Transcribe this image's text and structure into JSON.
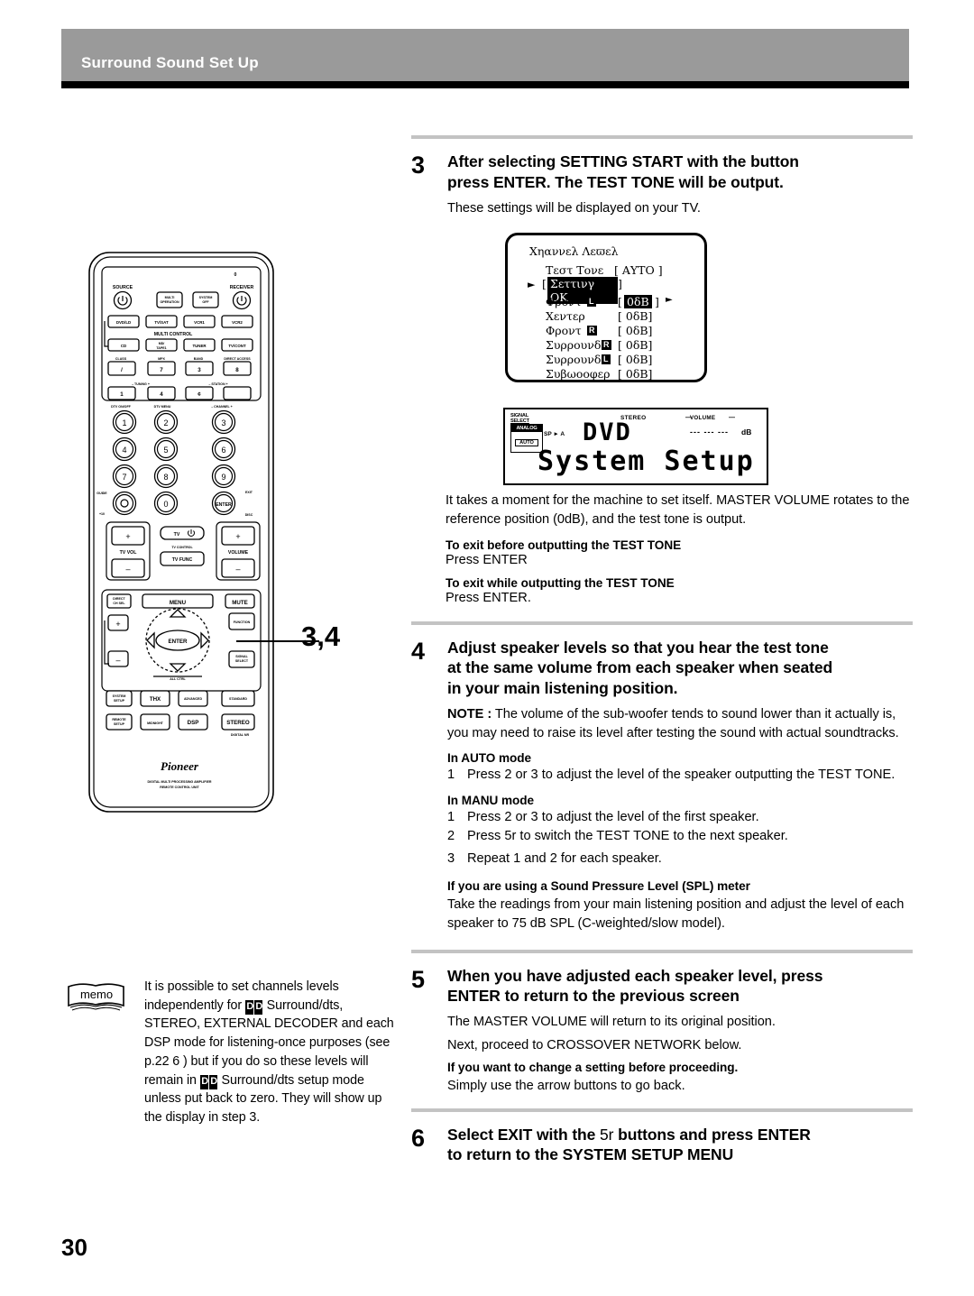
{
  "header": {
    "title": "Surround Sound Set Up"
  },
  "page": {
    "number": "30"
  },
  "callout": {
    "label": "3,4"
  },
  "steps": [
    {
      "num": "3",
      "title_line1": "After selecting SETTING START with the    button",
      "title_line2": "press ENTER. The TEST TONE will be output.",
      "intro": "These settings will be displayed on your  TV.",
      "body_para": "It takes a moment for the machine to set itself. MASTER VOLUME rotates to the reference position (0dB), and the test tone is output.",
      "exit_before_heading": "To exit before outputting the TEST TONE",
      "exit_before_text": "Press ENTER",
      "exit_while_heading": "To exit while outputting the TEST TONE",
      "exit_while_text": "Press ENTER."
    },
    {
      "num": "4",
      "title_line1": "Adjust speaker levels so that you hear the test tone",
      "title_line2": "at the same volume from each speaker when seated",
      "title_line3": "in your main listening position.",
      "note_label": "NOTE :",
      "note_text": " The volume of the sub-woofer tends to sound lower than it actually is, you may need to raise its level after testing the sound with actual soundtracks.",
      "auto_heading": "In AUTO mode",
      "auto_items": [
        {
          "n": "1",
          "t": "Press 2  or 3  to adjust the level of the speaker outputting the TEST TONE."
        }
      ],
      "manu_heading": "In MANU mode",
      "manu_items": [
        {
          "n": "1",
          "t": "Press 2  or 3  to adjust the level of the first speaker."
        },
        {
          "n": "2",
          "t": "Press  5r    to  switch the TEST TONE to the next speaker."
        },
        {
          "n": "3",
          "t": "Repeat 1  and 2  for each speaker."
        }
      ],
      "spl_heading": "If you are using a Sound Pressure Level (SPL) meter",
      "spl_text": "Take the readings from your main listening position and adjust the level of each speaker to 75 dB SPL (C-weighted/slow model)."
    },
    {
      "num": "5",
      "title_line1": "When you have adjusted each speaker level, press",
      "title_line2": "ENTER to return to the previous screen",
      "line1": "The MASTER VOLUME will return to its original position.",
      "line2": "Next, proceed to CROSSOVER NETWORK below.",
      "change_heading": "If you want to change a setting before proceeding.",
      "change_text": "Simply use the arrow buttons to go back."
    },
    {
      "num": "6",
      "title_line1_a": "Select EXIT with the ",
      "title_line1_b": "5r",
      "title_line1_c": "    buttons and press ENTER",
      "title_line2": "to return to the SYSTEM  SETUP MENU"
    }
  ],
  "osd": {
    "title": "Χηαννελ Λεϖελ",
    "test_tone_label": "Τεστ Τονε",
    "test_tone_value": "[ ΑΥΤΟ ]",
    "setting_ok": "Σεττινγ ΟΚ",
    "setting_ok_bracket_open": "[",
    "setting_ok_bracket_close": "]",
    "cursor": "►",
    "rows": [
      {
        "label": "Φροντ",
        "chip": "L",
        "value": "0δB",
        "bracket_open": "[",
        "bracket_close": "]",
        "selected": true,
        "left_arrow": "◄",
        "right_arrow": "►"
      },
      {
        "label": "Χεντερ",
        "chip": "",
        "value": "0δB",
        "bracket_open": "[",
        "bracket_close": "]",
        "selected": false
      },
      {
        "label": "Φροντ",
        "chip": "R",
        "value": "0δB",
        "bracket_open": "[",
        "bracket_close": "]",
        "selected": false
      },
      {
        "label": "Συρρουνδ",
        "chip": "R",
        "value": "0δB",
        "bracket_open": "[",
        "bracket_close": "]",
        "selected": false
      },
      {
        "label": "Συρρουνδ",
        "chip": "L",
        "value": "0δB",
        "bracket_open": "[",
        "bracket_close": "]",
        "selected": false
      },
      {
        "label": "Συβωοοφερ",
        "chip": "",
        "value": "0δB",
        "bracket_open": "[",
        "bracket_close": "]",
        "selected": false
      }
    ]
  },
  "fl_display": {
    "signal_select_l1": "SIGNAL",
    "signal_select_l2": "SELECT",
    "analog": "ANALOG",
    "auto": "AUTO",
    "sp_a": "SP ► A",
    "stereo": "STEREO",
    "volume": "VOLUME",
    "vol_dash_left": "—",
    "vol_dash_right": "—",
    "vol_segments": "--- --- ---",
    "db": "dB",
    "line1": "DVD",
    "line2": "System Setup"
  },
  "memo": {
    "icon_label": "memo",
    "text_part1": "It is possible to set channels levels independently for ",
    "text_part2": " Surround/dts, STEREO, EXTERNAL DECODER and each DSP mode for listening-once purposes (see p.22 6 ) but if you do so these levels will remain in ",
    "text_part3": " Surround/dts setup mode unless put back to zero. They will show up the display in step 3."
  },
  "remote": {
    "top_right_num": "0",
    "source_label": "SOURCE",
    "receiver_label": "RECEIVER",
    "multi_operation": "MULTI OPERATION",
    "system_off": "SYSTEM OFF",
    "input_row1": [
      "DVD/LD",
      "TV/SAT",
      "VCR1",
      "VCR2"
    ],
    "multi_control": "MULTI CONTROL",
    "input_row2": [
      "CD",
      "MD/TAPE1",
      "TUNER",
      "TV/CONT"
    ],
    "fn_labels": [
      "CLASS",
      "MPX",
      "BAND",
      "DIRECT ACCESS"
    ],
    "fn_keys": [
      "/",
      "7",
      "3",
      "8"
    ],
    "tuning_label": "– TUNING +",
    "station_label": "– STATION +",
    "tuning_keys": [
      "1",
      "4",
      "¢",
      ""
    ],
    "dtv_onoff": "DTV ON/OFF",
    "dtv_menu": "DTV MENU",
    "channel_label": "– CHANNEL +",
    "keypad": [
      "1",
      "2",
      "3",
      "4",
      "5",
      "6",
      "7",
      "8",
      "9"
    ],
    "guide": "GUIDE",
    "plus10": "+10",
    "zero": "0",
    "enter": "ENTER",
    "exit": "EXIT",
    "disc": "DISC",
    "tv_vol": "TV VOL",
    "tv_power": "TV",
    "tv_control": "TV CONTROL",
    "tv_func": "TV FUNC",
    "volume": "VOLUME",
    "plus": "+",
    "minus": "–",
    "direct_ch_sel_l1": "DIRECT",
    "direct_ch_sel_l2": "CH SEL",
    "menu": "MENU",
    "mute": "MUTE",
    "function": "FUNCTION",
    "signal_select_l1": "SIGNAL",
    "signal_select_l2": "SELECT",
    "up_arrow": "▲",
    "down_arrow": "▼",
    "left_arrow": "◄",
    "right_arrow": "►",
    "enter_pad": "ENTER",
    "all_ctrl": "ALL CTRL",
    "system_setup_l1": "SYSTEM",
    "system_setup_l2": "SETUP",
    "thx": "THX",
    "advanced": "ADVANCED",
    "standard": "STANDARD",
    "remote_setup_l1": "REMOTE",
    "remote_setup_l2": "SETUP",
    "midnight": "MIDNIGHT",
    "dsp": "DSP",
    "stereo": "STEREO",
    "digital_nr": "DIGITAL NR",
    "brand": "Pioneer",
    "footer_l1": "DIGITAL MULTI PROCESSING AMPLIFIER",
    "footer_l2": "REMOTE CONTROL UNIT"
  }
}
